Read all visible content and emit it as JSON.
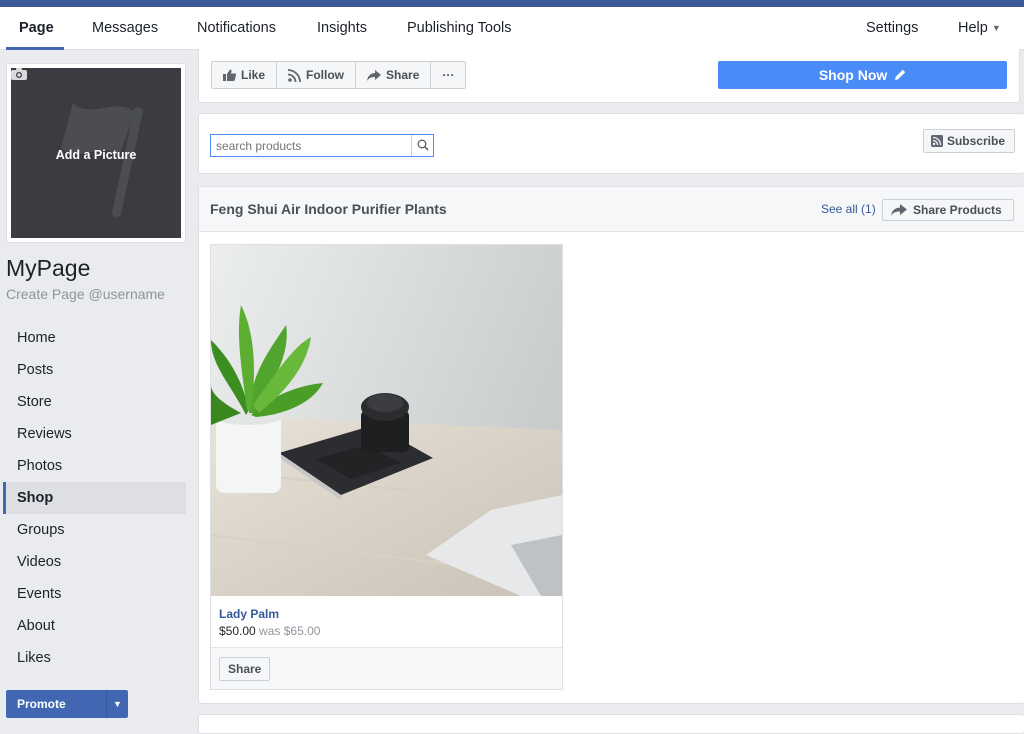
{
  "topnav": {
    "tabs": [
      {
        "label": "Page",
        "active": true
      },
      {
        "label": "Messages"
      },
      {
        "label": "Notifications"
      },
      {
        "label": "Insights"
      },
      {
        "label": "Publishing Tools"
      }
    ],
    "settings_label": "Settings",
    "help_label": "Help"
  },
  "sidebar": {
    "add_picture_label": "Add a Picture",
    "page_name": "MyPage",
    "username_link": "Create Page @username",
    "items": [
      {
        "label": "Home"
      },
      {
        "label": "Posts"
      },
      {
        "label": "Store"
      },
      {
        "label": "Reviews"
      },
      {
        "label": "Photos"
      },
      {
        "label": "Shop",
        "active": true
      },
      {
        "label": "Groups"
      },
      {
        "label": "Videos"
      },
      {
        "label": "Events"
      },
      {
        "label": "About"
      },
      {
        "label": "Likes"
      }
    ],
    "promote_label": "Promote"
  },
  "actions": {
    "like_label": "Like",
    "follow_label": "Follow",
    "share_label": "Share",
    "more_label": "···",
    "shop_now_label": "Shop Now"
  },
  "shop": {
    "search_placeholder": "search products",
    "subscribe_label": "Subscribe",
    "collection_title": "Feng Shui Air Indoor Purifier Plants",
    "see_all_label": "See all (1)",
    "share_products_label": "Share Products",
    "products": [
      {
        "name": "Lady Palm",
        "price": "$50.00",
        "was_label": "was $65.00",
        "share_label": "Share"
      }
    ]
  },
  "colors": {
    "brand": "#3b5998",
    "accent": "#4267b2",
    "shop_now": "#4a8cf7",
    "background": "#e9ebee"
  }
}
